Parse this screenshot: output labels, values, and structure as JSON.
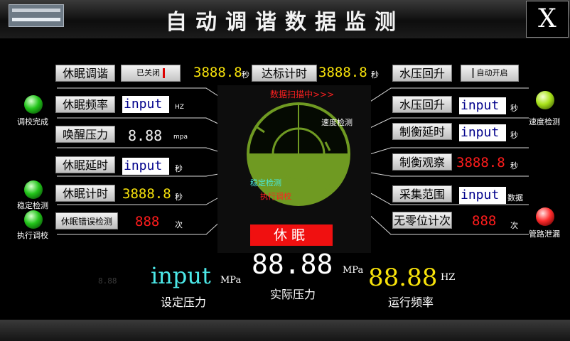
{
  "header": {
    "title": "自动调谐数据监测",
    "close_label": "X"
  },
  "left_rows": [
    {
      "label": "休眠调谐",
      "kind": "switch",
      "value": "已关闭"
    },
    {
      "label": "休眠频率",
      "kind": "input",
      "value": "input",
      "unit": "HZ"
    },
    {
      "label": "唤醒压力",
      "kind": "number",
      "value": "8.88",
      "unit": "mpa"
    },
    {
      "label": "休眠延时",
      "kind": "input",
      "value": "input",
      "unit": "秒"
    },
    {
      "label": "休眠计时",
      "kind": "segment",
      "value": "3888.8",
      "unit": "秒"
    },
    {
      "label": "休眠错误检测",
      "kind": "segment",
      "value": "888",
      "unit": "次"
    }
  ],
  "right_rows": [
    {
      "label": "水压回升",
      "kind": "switch",
      "value": "自动开启"
    },
    {
      "label": "水压回升",
      "kind": "input",
      "value": "input",
      "unit": "秒"
    },
    {
      "label": "制衡延时",
      "kind": "input",
      "value": "input",
      "unit": "秒"
    },
    {
      "label": "制衡观察",
      "kind": "segment",
      "value": "3888.8",
      "unit": "秒"
    },
    {
      "label": "采集范围",
      "kind": "input",
      "value": "input",
      "unit": "数据"
    },
    {
      "label": "无零位计次",
      "kind": "segment",
      "value": "888",
      "unit": "次"
    }
  ],
  "top_center": {
    "left_value": "3888.8",
    "left_unit": "秒",
    "button": "达标计时",
    "right_value": "3888.8",
    "right_unit": "秒"
  },
  "radar": {
    "scan_text": "数据扫描中>>>",
    "speed_check": "速度检测",
    "stable_check": "稳定检测",
    "exec_tune": "执行调校",
    "status": "休眠"
  },
  "indicators": {
    "tune_done": "调校完成",
    "stable_check": "稳定检测",
    "exec_tune": "执行调校",
    "speed_check": "速度检测",
    "pipe_leak": "管路泄漏"
  },
  "bottom": {
    "set_value": "input",
    "set_unit": "MPa",
    "set_label": "设定压力",
    "set_ghost": "8.88",
    "actual_value": "88.88",
    "actual_unit": "MPa",
    "actual_label": "实际压力",
    "freq_value": "88.88",
    "freq_unit": "HZ",
    "freq_label": "运行频率"
  },
  "colors": {
    "segment_yellow": "#f7e20a",
    "segment_red": "#ff1c1c",
    "radar_green": "#78a020",
    "status_red": "#f01010"
  }
}
